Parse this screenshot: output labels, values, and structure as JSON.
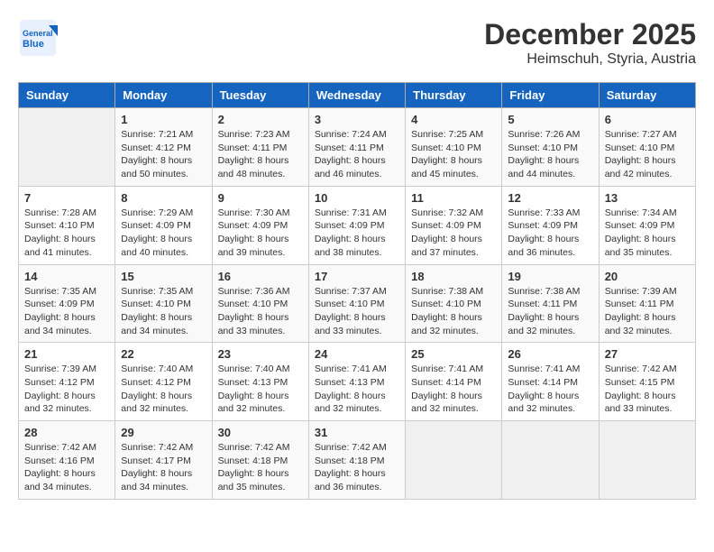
{
  "header": {
    "logo_line1": "General",
    "logo_line2": "Blue",
    "month": "December 2025",
    "location": "Heimschuh, Styria, Austria"
  },
  "weekdays": [
    "Sunday",
    "Monday",
    "Tuesday",
    "Wednesday",
    "Thursday",
    "Friday",
    "Saturday"
  ],
  "weeks": [
    [
      {
        "day": null
      },
      {
        "day": 1,
        "sunrise": "7:21 AM",
        "sunset": "4:12 PM",
        "daylight": "8 hours and 50 minutes."
      },
      {
        "day": 2,
        "sunrise": "7:23 AM",
        "sunset": "4:11 PM",
        "daylight": "8 hours and 48 minutes."
      },
      {
        "day": 3,
        "sunrise": "7:24 AM",
        "sunset": "4:11 PM",
        "daylight": "8 hours and 46 minutes."
      },
      {
        "day": 4,
        "sunrise": "7:25 AM",
        "sunset": "4:10 PM",
        "daylight": "8 hours and 45 minutes."
      },
      {
        "day": 5,
        "sunrise": "7:26 AM",
        "sunset": "4:10 PM",
        "daylight": "8 hours and 44 minutes."
      },
      {
        "day": 6,
        "sunrise": "7:27 AM",
        "sunset": "4:10 PM",
        "daylight": "8 hours and 42 minutes."
      }
    ],
    [
      {
        "day": 7,
        "sunrise": "7:28 AM",
        "sunset": "4:10 PM",
        "daylight": "8 hours and 41 minutes."
      },
      {
        "day": 8,
        "sunrise": "7:29 AM",
        "sunset": "4:09 PM",
        "daylight": "8 hours and 40 minutes."
      },
      {
        "day": 9,
        "sunrise": "7:30 AM",
        "sunset": "4:09 PM",
        "daylight": "8 hours and 39 minutes."
      },
      {
        "day": 10,
        "sunrise": "7:31 AM",
        "sunset": "4:09 PM",
        "daylight": "8 hours and 38 minutes."
      },
      {
        "day": 11,
        "sunrise": "7:32 AM",
        "sunset": "4:09 PM",
        "daylight": "8 hours and 37 minutes."
      },
      {
        "day": 12,
        "sunrise": "7:33 AM",
        "sunset": "4:09 PM",
        "daylight": "8 hours and 36 minutes."
      },
      {
        "day": 13,
        "sunrise": "7:34 AM",
        "sunset": "4:09 PM",
        "daylight": "8 hours and 35 minutes."
      }
    ],
    [
      {
        "day": 14,
        "sunrise": "7:35 AM",
        "sunset": "4:09 PM",
        "daylight": "8 hours and 34 minutes."
      },
      {
        "day": 15,
        "sunrise": "7:35 AM",
        "sunset": "4:10 PM",
        "daylight": "8 hours and 34 minutes."
      },
      {
        "day": 16,
        "sunrise": "7:36 AM",
        "sunset": "4:10 PM",
        "daylight": "8 hours and 33 minutes."
      },
      {
        "day": 17,
        "sunrise": "7:37 AM",
        "sunset": "4:10 PM",
        "daylight": "8 hours and 33 minutes."
      },
      {
        "day": 18,
        "sunrise": "7:38 AM",
        "sunset": "4:10 PM",
        "daylight": "8 hours and 32 minutes."
      },
      {
        "day": 19,
        "sunrise": "7:38 AM",
        "sunset": "4:11 PM",
        "daylight": "8 hours and 32 minutes."
      },
      {
        "day": 20,
        "sunrise": "7:39 AM",
        "sunset": "4:11 PM",
        "daylight": "8 hours and 32 minutes."
      }
    ],
    [
      {
        "day": 21,
        "sunrise": "7:39 AM",
        "sunset": "4:12 PM",
        "daylight": "8 hours and 32 minutes."
      },
      {
        "day": 22,
        "sunrise": "7:40 AM",
        "sunset": "4:12 PM",
        "daylight": "8 hours and 32 minutes."
      },
      {
        "day": 23,
        "sunrise": "7:40 AM",
        "sunset": "4:13 PM",
        "daylight": "8 hours and 32 minutes."
      },
      {
        "day": 24,
        "sunrise": "7:41 AM",
        "sunset": "4:13 PM",
        "daylight": "8 hours and 32 minutes."
      },
      {
        "day": 25,
        "sunrise": "7:41 AM",
        "sunset": "4:14 PM",
        "daylight": "8 hours and 32 minutes."
      },
      {
        "day": 26,
        "sunrise": "7:41 AM",
        "sunset": "4:14 PM",
        "daylight": "8 hours and 32 minutes."
      },
      {
        "day": 27,
        "sunrise": "7:42 AM",
        "sunset": "4:15 PM",
        "daylight": "8 hours and 33 minutes."
      }
    ],
    [
      {
        "day": 28,
        "sunrise": "7:42 AM",
        "sunset": "4:16 PM",
        "daylight": "8 hours and 34 minutes."
      },
      {
        "day": 29,
        "sunrise": "7:42 AM",
        "sunset": "4:17 PM",
        "daylight": "8 hours and 34 minutes."
      },
      {
        "day": 30,
        "sunrise": "7:42 AM",
        "sunset": "4:18 PM",
        "daylight": "8 hours and 35 minutes."
      },
      {
        "day": 31,
        "sunrise": "7:42 AM",
        "sunset": "4:18 PM",
        "daylight": "8 hours and 36 minutes."
      },
      {
        "day": null
      },
      {
        "day": null
      },
      {
        "day": null
      }
    ]
  ]
}
